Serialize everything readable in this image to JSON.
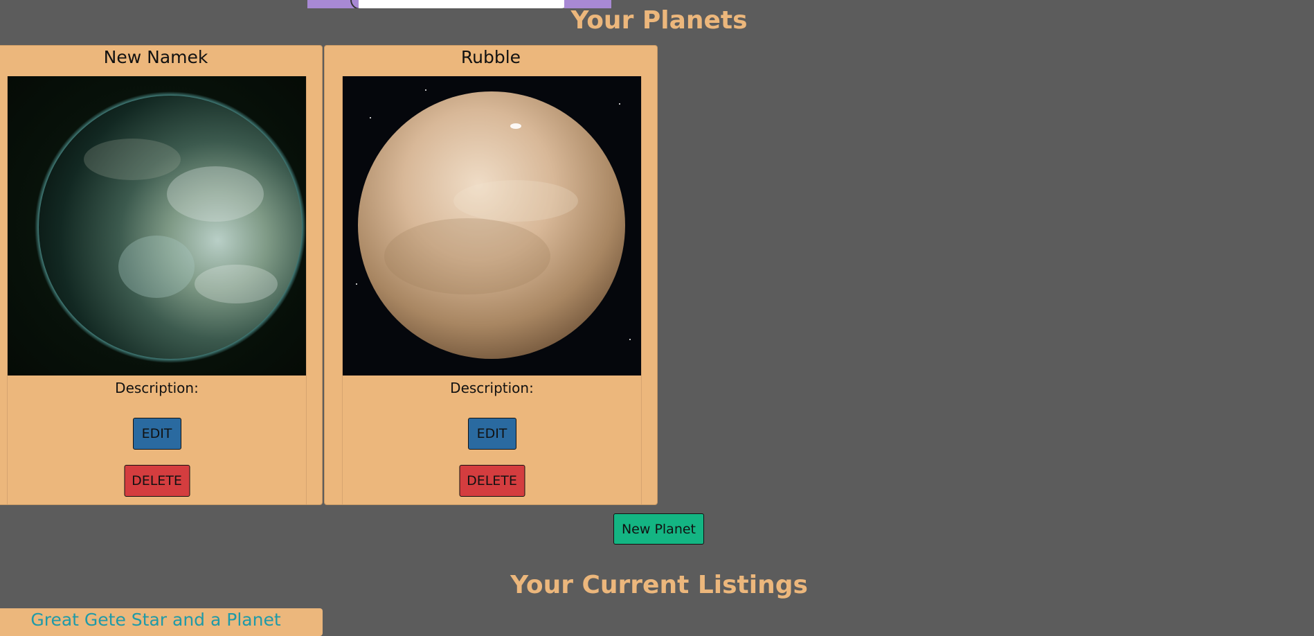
{
  "page": {
    "planets_heading": "Your Planets",
    "listings_heading": "Your Current Listings"
  },
  "planets": [
    {
      "name": "New Namek",
      "description_label": "Description:",
      "edit_label": "EDIT",
      "delete_label": "DELETE"
    },
    {
      "name": "Rubble",
      "description_label": "Description:",
      "edit_label": "EDIT",
      "delete_label": "DELETE"
    }
  ],
  "actions": {
    "new_planet_label": "New Planet"
  },
  "listings": [
    {
      "name": "Great Gete Star and a Planet"
    }
  ],
  "colors": {
    "background": "#5c5c5c",
    "accent": "#ecb77c",
    "edit_button": "#2a6aa0",
    "delete_button": "#d43d3f",
    "new_button": "#14b583",
    "listing_link": "#1f9aa8"
  }
}
